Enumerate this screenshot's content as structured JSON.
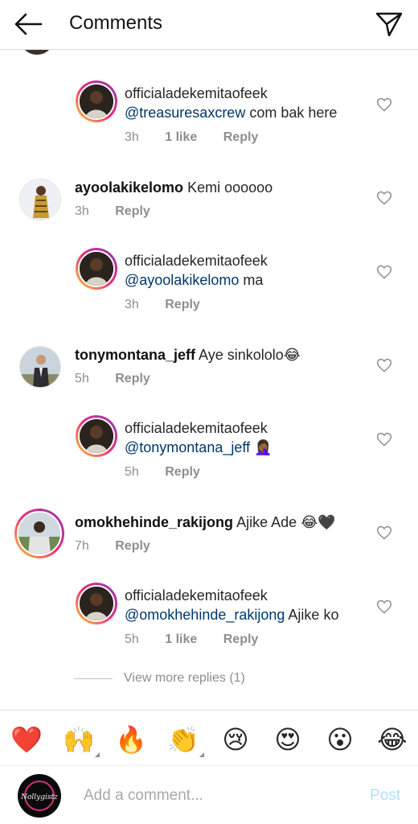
{
  "header": {
    "title": "Comments"
  },
  "comments": [
    {
      "username": "officialadekemitaofeek",
      "mention": "@treasuresaxcrew",
      "text": "com bak here",
      "time": "3h",
      "likes": "1 like",
      "reply": "Reply"
    },
    {
      "username": "ayoolakikelomo",
      "text": "Kemi oooooo",
      "time": "3h",
      "reply": "Reply"
    },
    {
      "username": "officialadekemitaofeek",
      "mention": "@ayoolakikelomo",
      "text": "ma",
      "time": "3h",
      "reply": "Reply"
    },
    {
      "username": "tonymontana_jeff",
      "text": "Aye sinkololo😂",
      "time": "5h",
      "reply": "Reply"
    },
    {
      "username": "officialadekemitaofeek",
      "mention": "@tonymontana_jeff",
      "text": "🤦🏾‍♀️",
      "time": "5h",
      "reply": "Reply"
    },
    {
      "username": "omokhehinde_rakijong",
      "text": "Ajike Ade 😂🖤",
      "time": "7h",
      "reply": "Reply"
    },
    {
      "username": "officialadekemitaofeek",
      "mention": "@omokhehinde_rakijong",
      "text": "Ajike ko",
      "time": "5h",
      "likes": "1 like",
      "reply": "Reply"
    }
  ],
  "view_more": "View more replies (1)",
  "reactions": [
    "❤️",
    "🙌",
    "🔥",
    "👏",
    "😢",
    "😍",
    "😮",
    "😂"
  ],
  "composer": {
    "placeholder": "Add a comment...",
    "post_label": "Post",
    "avatar_brand": "Nollygistz"
  },
  "colors": {
    "mention": "#00376b",
    "meta": "#8e8e8e",
    "post_disabled": "#b2dffc",
    "story_ring": "#ee2a7b"
  }
}
